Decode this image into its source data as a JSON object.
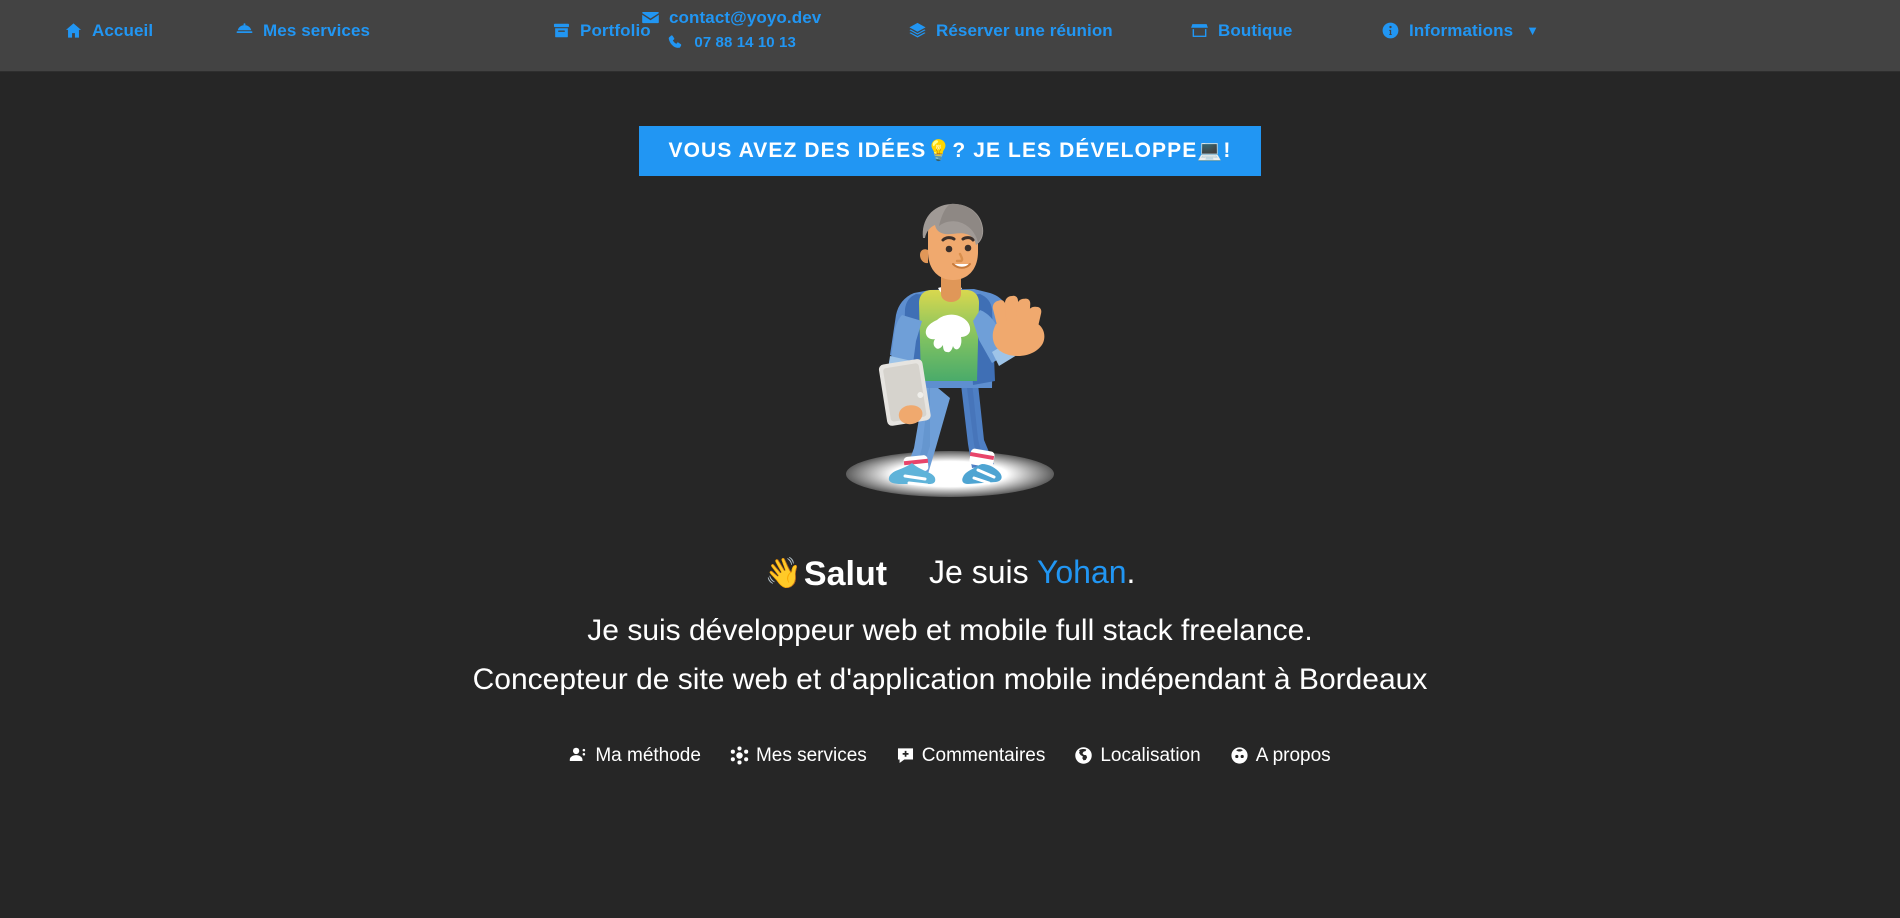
{
  "theme": {
    "nav_bg": "#434343",
    "page_bg": "#262626",
    "accent": "#2196f3",
    "text": "#ffffff"
  },
  "nav": {
    "accueil": {
      "label": "Accueil",
      "icon": "home-icon"
    },
    "services": {
      "label": "Mes services",
      "icon": "serving-dome-icon"
    },
    "portfolio": {
      "label": "Portfolio",
      "icon": "archive-box-icon"
    },
    "email": {
      "label": "contact@yoyo.dev",
      "icon": "envelope-icon"
    },
    "phone": {
      "label": "07 88 14 10 13",
      "icon": "phone-icon"
    },
    "reserver": {
      "label": "Réserver une réunion",
      "icon": "layers-icon"
    },
    "boutique": {
      "label": "Boutique",
      "icon": "shop-icon"
    },
    "informations": {
      "label": "Informations",
      "icon": "info-circle-icon",
      "caret": "▼"
    }
  },
  "hero": {
    "tagline_before": "VOUS AVEZ DES IDÉES",
    "tagline_bulb": "💡",
    "tagline_middle": " ? JE LES DÉVELOPPE",
    "tagline_laptop": "💻",
    "tagline_after": " !",
    "illustration_name": "waving-developer-illustration",
    "wave_emoji": "👋",
    "salut": "Salut",
    "je_suis": "Je suis ",
    "name": "Yohan",
    "period": ".",
    "line1": "Je suis développeur web et mobile full stack freelance.",
    "line2": "Concepteur de site web et d'application mobile indépendant à Bordeaux"
  },
  "quicklinks": [
    {
      "label": "Ma méthode",
      "icon": "user-gear-icon"
    },
    {
      "label": "Mes services",
      "icon": "molecule-icon"
    },
    {
      "label": "Commentaires",
      "icon": "comment-plus-icon"
    },
    {
      "label": "Localisation",
      "icon": "globe-icon"
    },
    {
      "label": "A propos",
      "icon": "face-icon"
    }
  ]
}
